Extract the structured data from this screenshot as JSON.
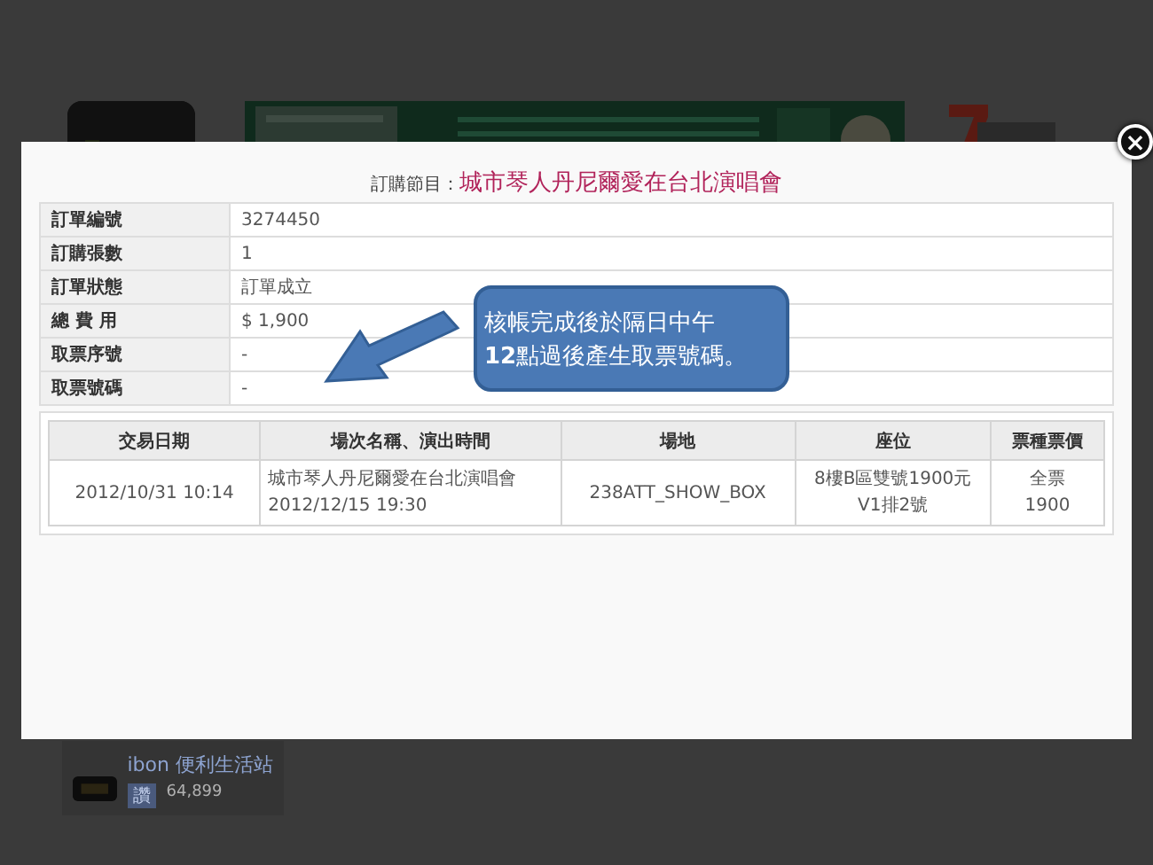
{
  "background": {
    "fan_box": {
      "name": "ibon 便利生活站",
      "like": "讚",
      "count": "64,899"
    }
  },
  "modal": {
    "close": "×",
    "title_label": "訂購節目：",
    "title": "城市琴人丹尼爾愛在台北演唱會",
    "fields": [
      {
        "label": "訂單編號",
        "value": "3274450"
      },
      {
        "label": "訂購張數",
        "value": "1"
      },
      {
        "label": "訂單狀態",
        "value": "訂單成立"
      },
      {
        "label": "總 費 用",
        "value": "$ 1,900"
      },
      {
        "label": "取票序號",
        "value": "-"
      },
      {
        "label": "取票號碼",
        "value": "-"
      }
    ],
    "callout": "核帳完成後於隔日中午\n**12**點過後產生取票號碼。",
    "details": {
      "columns": [
        "交易日期",
        "場次名稱、演出時間",
        "場地",
        "座位",
        "票種票價"
      ],
      "rows": [
        {
          "date": "2012/10/31 10:14",
          "event": "城市琴人丹尼爾愛在台北演唱會",
          "time": "2012/12/15 19:30",
          "venue": "238ATT_SHOW_BOX",
          "seat": "8樓B區雙號1900元\nV1排2號",
          "ticket": "全票\n1900"
        }
      ]
    }
  }
}
